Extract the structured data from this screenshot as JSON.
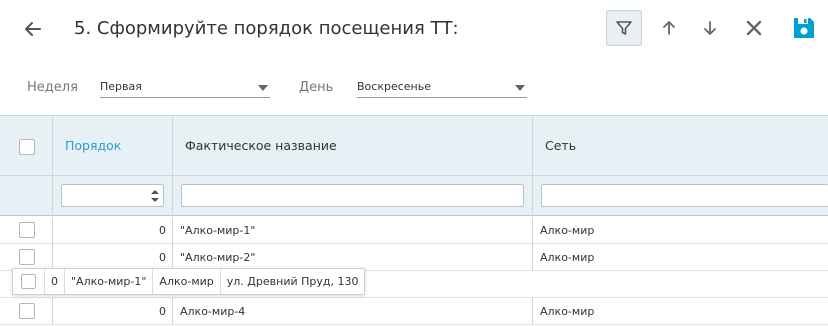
{
  "header": {
    "title": "5. Сформируйте порядок посещения ТТ:"
  },
  "colors": {
    "accent": "#2a9fd6",
    "save": "#00a0d2",
    "header_bg": "#e6f0f5"
  },
  "icons": {
    "back": "arrow-left-icon",
    "filter": "filter-icon",
    "up": "arrow-up-icon",
    "down": "arrow-down-icon",
    "close": "close-icon",
    "save": "floppy-disk-icon"
  },
  "filters": {
    "week_label": "Неделя",
    "week_value": "Первая",
    "day_label": "День",
    "day_value": "Воскресенье"
  },
  "grid": {
    "columns": [
      "Порядок",
      "Фактическое название",
      "Сеть"
    ],
    "rows": [
      {
        "order": "0",
        "name": "\"Алко-мир-1\"",
        "network": "Алко-мир"
      },
      {
        "order": "0",
        "name": "\"Алко-мир-2\"",
        "network": "Алко-мир"
      },
      {
        "order": "0",
        "name": "Алко-мир-4",
        "network": "Алко-мир"
      }
    ],
    "dragged_row": {
      "order": "0",
      "name": "\"Алко-мир-1\"",
      "network": "Алко-мир",
      "address": "ул. Древний Пруд, 130"
    }
  }
}
